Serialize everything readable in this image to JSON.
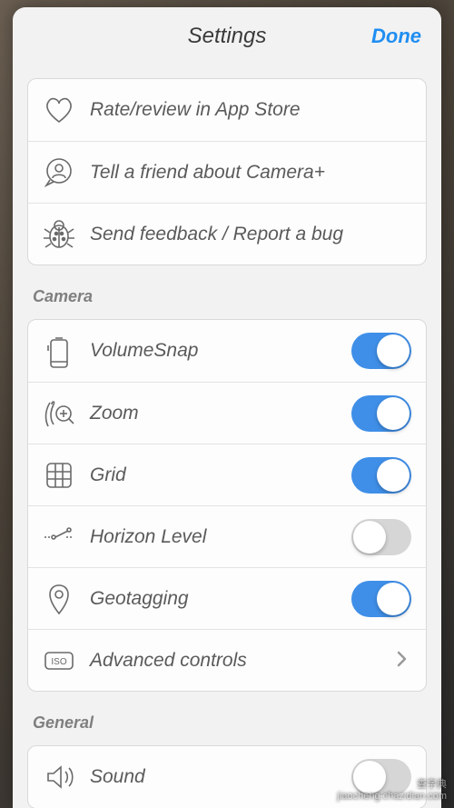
{
  "header": {
    "title": "Settings",
    "done": "Done"
  },
  "feedback_group": [
    {
      "icon": "heart",
      "label": "Rate/review in App Store"
    },
    {
      "icon": "tell-friend",
      "label": "Tell a friend about Camera+"
    },
    {
      "icon": "bug",
      "label": "Send feedback / Report a bug"
    }
  ],
  "sections": {
    "camera": {
      "title": "Camera",
      "rows": [
        {
          "icon": "volumesnap",
          "label": "VolumeSnap",
          "type": "toggle",
          "on": true
        },
        {
          "icon": "zoom",
          "label": "Zoom",
          "type": "toggle",
          "on": true
        },
        {
          "icon": "grid",
          "label": "Grid",
          "type": "toggle",
          "on": true
        },
        {
          "icon": "horizon",
          "label": "Horizon Level",
          "type": "toggle",
          "on": false
        },
        {
          "icon": "geotag",
          "label": "Geotagging",
          "type": "toggle",
          "on": true
        },
        {
          "icon": "iso",
          "label": "Advanced controls",
          "type": "disclosure"
        }
      ]
    },
    "general": {
      "title": "General",
      "rows": [
        {
          "icon": "sound",
          "label": "Sound",
          "type": "toggle",
          "on": false
        }
      ]
    }
  },
  "watermark": {
    "line1": "查字典",
    "line2": "jiaocheng.chazidian.com"
  }
}
